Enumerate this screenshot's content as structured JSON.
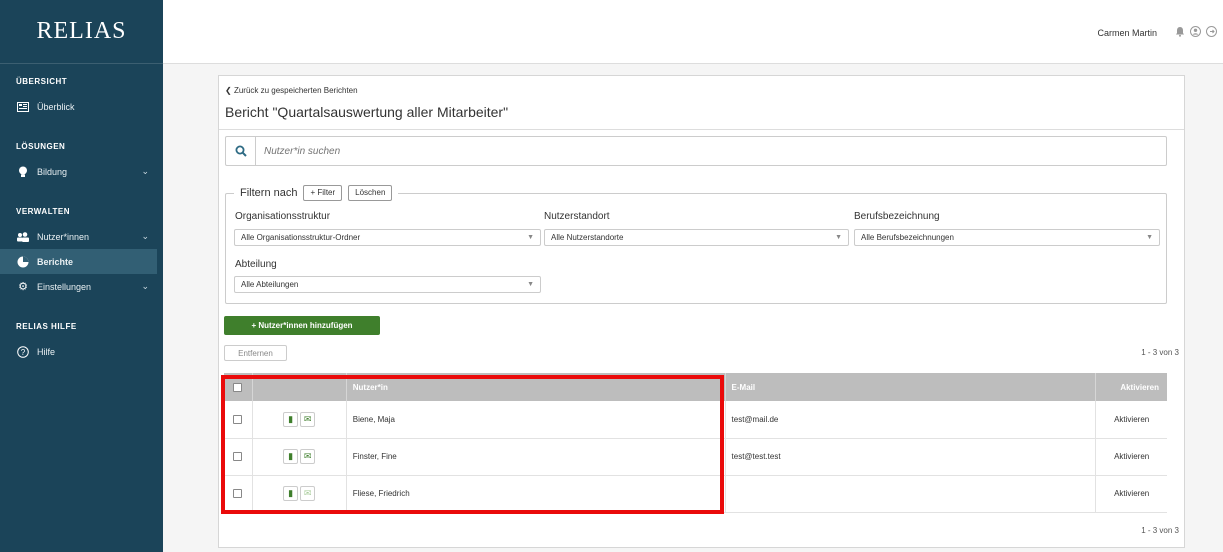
{
  "brand": "RELIAS",
  "sidebar": {
    "sections": [
      {
        "title": "ÜBERSICHT",
        "items": [
          {
            "label": "Überblick",
            "icon": "dashboard-icon"
          }
        ]
      },
      {
        "title": "LÖSUNGEN",
        "items": [
          {
            "label": "Bildung",
            "icon": "lightbulb-icon",
            "expandable": true
          }
        ]
      },
      {
        "title": "VERWALTEN",
        "items": [
          {
            "label": "Nutzer*innen",
            "icon": "users-icon",
            "expandable": true
          },
          {
            "label": "Berichte",
            "icon": "pie-chart-icon",
            "active": true
          },
          {
            "label": "Einstellungen",
            "icon": "gear-icon",
            "expandable": true
          }
        ]
      },
      {
        "title": "RELIAS HILFE",
        "items": [
          {
            "label": "Hilfe",
            "icon": "help-icon"
          }
        ]
      }
    ]
  },
  "topbar": {
    "user_name": "Carmen Martin",
    "icons": [
      "bell-icon",
      "user-circle-icon",
      "logout-icon"
    ]
  },
  "report": {
    "back_link": "Zurück zu gespeicherten Berichten",
    "title": "Bericht \"Quartalsauswertung aller Mitarbeiter\"",
    "search_placeholder": "Nutzer*in suchen",
    "filter": {
      "legend": "Filtern nach",
      "add_button": "+ Filter",
      "clear_button": "Löschen",
      "fields": [
        {
          "label": "Organisationsstruktur",
          "value": "Alle Organisationsstruktur-Ordner"
        },
        {
          "label": "Nutzerstandort",
          "value": "Alle Nutzerstandorte"
        },
        {
          "label": "Berufsbezeichnung",
          "value": "Alle Berufsbezeichnungen"
        },
        {
          "label": "Abteilung",
          "value": "Alle Abteilungen"
        }
      ]
    },
    "add_users_button": "+ Nutzer*innen hinzufügen",
    "remove_button": "Entfernen",
    "pagination": "1 - 3 von 3",
    "table": {
      "headers": {
        "user": "Nutzer*in",
        "email": "E-Mail",
        "activate": "Aktivieren"
      },
      "rows": [
        {
          "name": "Biene, Maja",
          "email": "test@mail.de",
          "action": "Aktivieren",
          "mail_enabled": true
        },
        {
          "name": "Finster, Fine",
          "email": "test@test.test",
          "action": "Aktivieren",
          "mail_enabled": true
        },
        {
          "name": "Fliese, Friedrich",
          "email": "",
          "action": "Aktivieren",
          "mail_enabled": false
        }
      ]
    }
  },
  "colors": {
    "sidebar": "#1b4459",
    "accent_green": "#3f7f2c",
    "highlight": "#ea0a0a"
  }
}
